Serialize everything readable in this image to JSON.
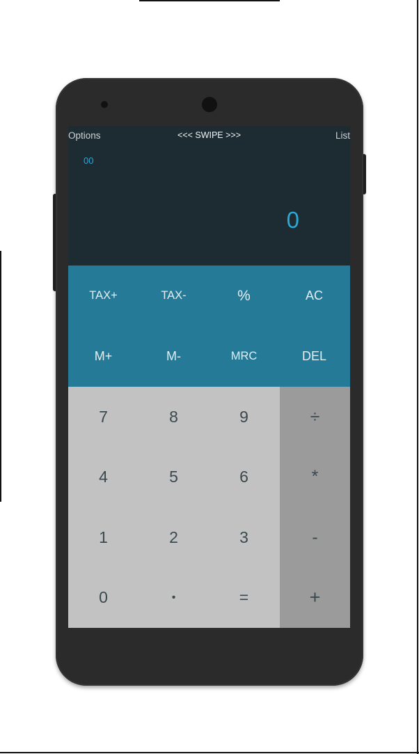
{
  "topbar": {
    "options_label": "Options",
    "swipe_label": "<<< SWIPE >>>",
    "list_label": "List"
  },
  "display": {
    "memory_value": "00",
    "result_value": "0"
  },
  "keys": {
    "function_row1": [
      "TAX+",
      "TAX-",
      "%",
      "AC"
    ],
    "function_row2": [
      "M+",
      "M-",
      "MRC",
      "DEL"
    ],
    "digits": [
      "7",
      "8",
      "9",
      "4",
      "5",
      "6",
      "1",
      "2",
      "3",
      "0",
      "•",
      "="
    ],
    "operators": [
      "÷",
      "*",
      "-",
      "+"
    ]
  },
  "colors": {
    "display_bg": "#1d2b33",
    "accent_text": "#2aa8d6",
    "function_pad": "#257a98",
    "number_pad": "#c2c2c2",
    "operator_pad": "#9b9b9b",
    "phone_body": "#2b2b2b"
  }
}
